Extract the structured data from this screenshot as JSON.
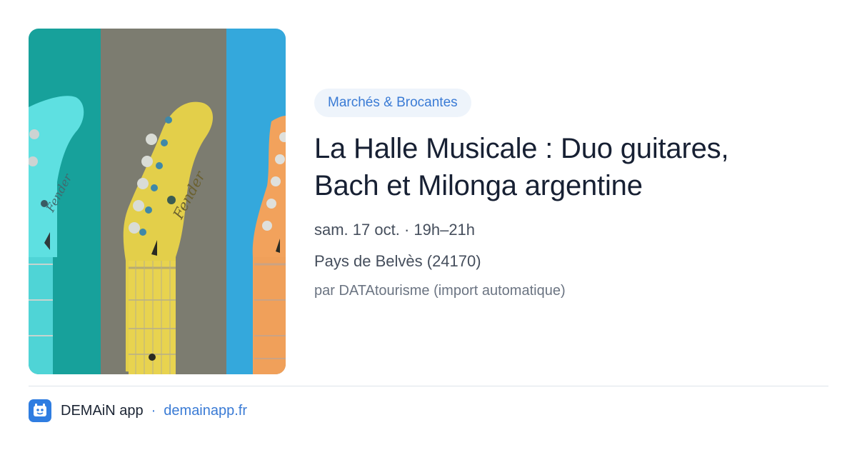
{
  "event": {
    "category": "Marchés & Brocantes",
    "title_line1": "La Halle Musicale : Duo guitares,",
    "title_line2": "Bach et Milonga argentine",
    "date": "sam. 17 oct. · 19h–21h",
    "place": "Pays de Belvès (24170)",
    "source": "par DATAtourisme (import automatique)"
  },
  "image": {
    "brand_text": "Fender",
    "panel_colors": [
      "#17a19b",
      "#7c7c70",
      "#34a8dc"
    ],
    "guitar_colors": [
      "#5ee0e1",
      "#e3cf4a",
      "#f2a25c"
    ]
  },
  "footer": {
    "app_name": "DEMAiN app",
    "separator": "·",
    "url": "demainapp.fr"
  },
  "colors": {
    "accent": "#3a7bd5",
    "chip_bg": "#eef4fb",
    "title": "#172033",
    "muted": "#6b7482",
    "logo_bg": "#2f7de1"
  },
  "icons": {
    "app_logo": "demain-logo-icon"
  }
}
